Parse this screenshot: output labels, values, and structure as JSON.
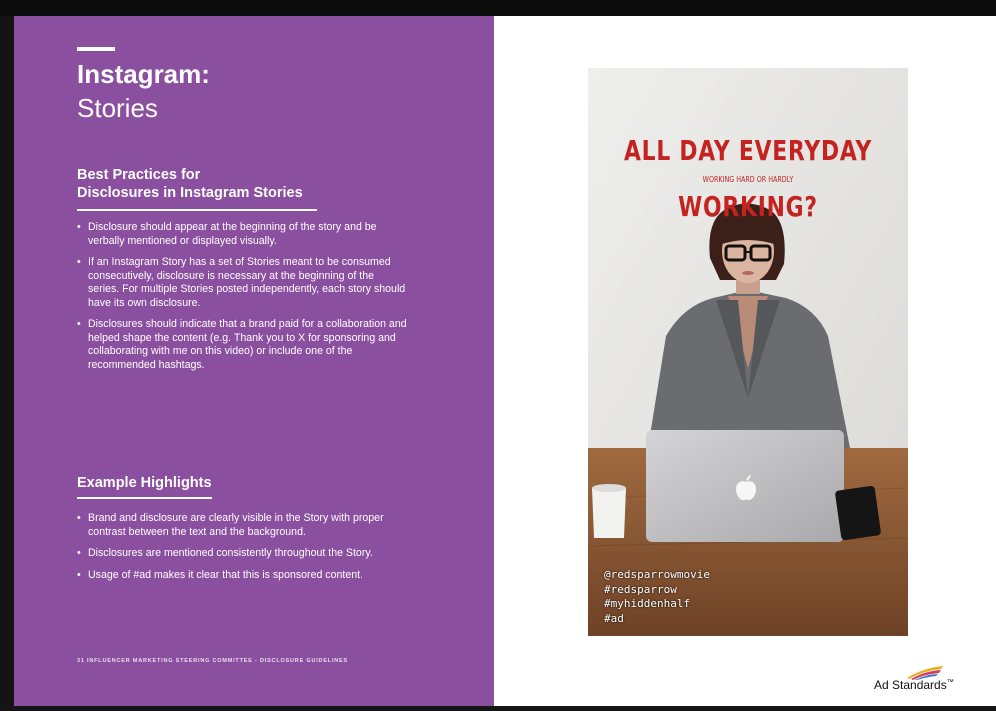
{
  "page": {
    "title": "Instagram:",
    "subtitle": "Stories",
    "best_practices": {
      "heading_line1": "Best Practices for",
      "heading_line2": "Disclosures in Instagram Stories",
      "items": [
        "Disclosure should appear at the beginning of the story and be verbally mentioned or displayed visually.",
        "If an Instagram Story has a set of Stories meant to be consumed consecutively, disclosure is necessary at the beginning of the series. For multiple Stories posted independently, each story should have its own disclosure.",
        "Disclosures should indicate that a brand paid for a collaboration and helped shape the content (e.g. Thank you to X for sponsoring and collaborating with me on this video) or include one of the recommended hashtags."
      ]
    },
    "example_highlights": {
      "heading": "Example Highlights",
      "items": [
        "Brand and disclosure are clearly visible in the Story with proper contrast between the text and the background.",
        "Disclosures are mentioned consistently throughout the Story.",
        "Usage of #ad makes it clear that this is sponsored content."
      ]
    },
    "footer": "31   INFLUENCER MARKETING STEERING COMMITTEE - DISCLOSURE GUIDELINES"
  },
  "story": {
    "headline_line1": "ALL DAY EVERYDAY",
    "headline_line2": "WORKING HARD OR HARDLY",
    "headline_line3": "WORKING?",
    "tags": [
      "@redsparrowmovie",
      "#redsparrow",
      "#myhiddenhalf",
      "#ad"
    ]
  },
  "brand": {
    "name": "Ad Standards",
    "trademark": "™"
  },
  "colors": {
    "panel_purple": "#8b4fa0",
    "headline_red": "#c4231f",
    "page_background": "#ffffff"
  },
  "icons": [
    "apple-logo-icon",
    "ad-standards-logo-icon"
  ]
}
